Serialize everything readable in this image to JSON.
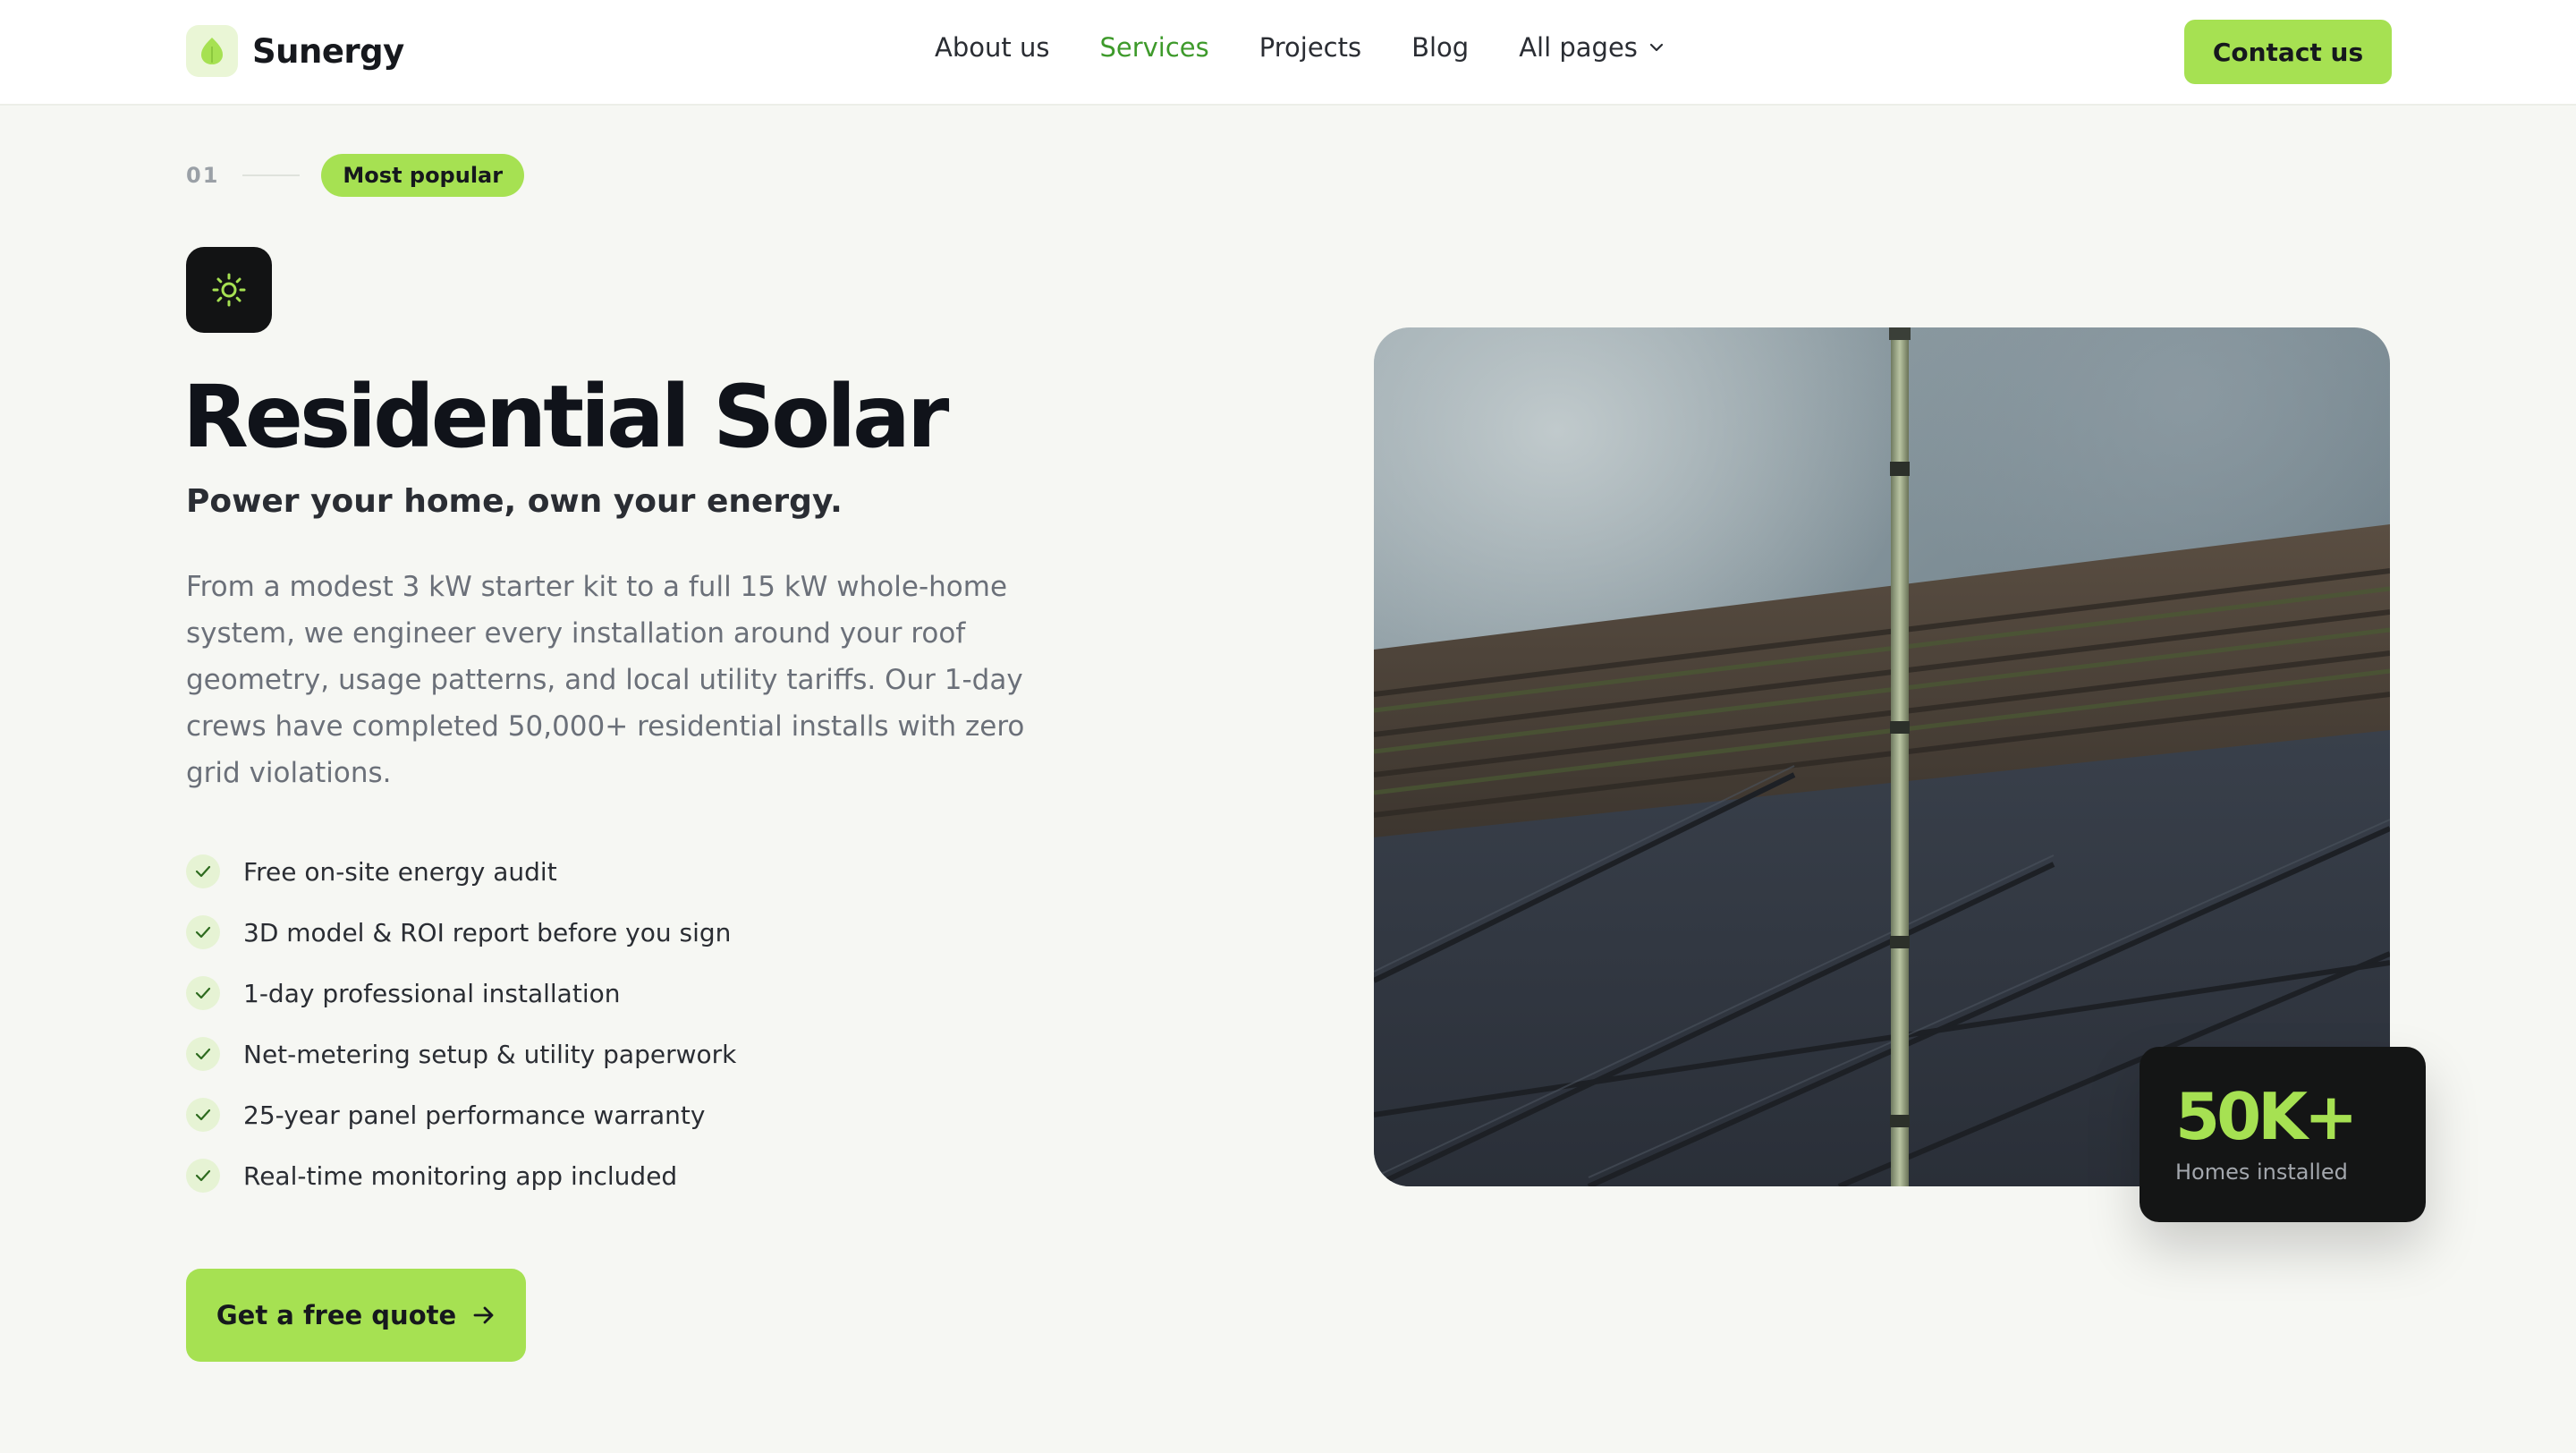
{
  "brand": {
    "name": "Sunergy",
    "accent_color": "#a6e152",
    "icon": "leaf-icon"
  },
  "nav": {
    "items": [
      {
        "label": "About us",
        "active": false
      },
      {
        "label": "Services",
        "active": true
      },
      {
        "label": "Projects",
        "active": false
      },
      {
        "label": "Blog",
        "active": false
      },
      {
        "label": "All pages",
        "active": false,
        "icon": "chevron-down-icon"
      }
    ],
    "active_color": "#3e9a2b"
  },
  "header": {
    "contact_label": "Contact us"
  },
  "service": {
    "number": "01",
    "badge": "Most popular",
    "icon": "sun-icon",
    "title": "Residential Solar",
    "subtitle": "Power your home, own your energy.",
    "description": "From a modest 3 kW starter kit to a full 15 kW whole-home system, we engineer every installation around your roof geometry, usage patterns, and local utility tariffs. Our 1-day crews have completed 50,000+ residential installs with zero grid violations.",
    "features": [
      "Free on-site energy audit",
      "3D model & ROI report before you sign",
      "1-day professional installation",
      "Net-metering setup & utility paperwork",
      "25-year panel performance warranty",
      "Real-time monitoring app included"
    ],
    "cta_label": "Get a free quote",
    "cta_icon": "arrow-right-icon"
  },
  "stat": {
    "value": "50K+",
    "label": "Homes installed"
  }
}
